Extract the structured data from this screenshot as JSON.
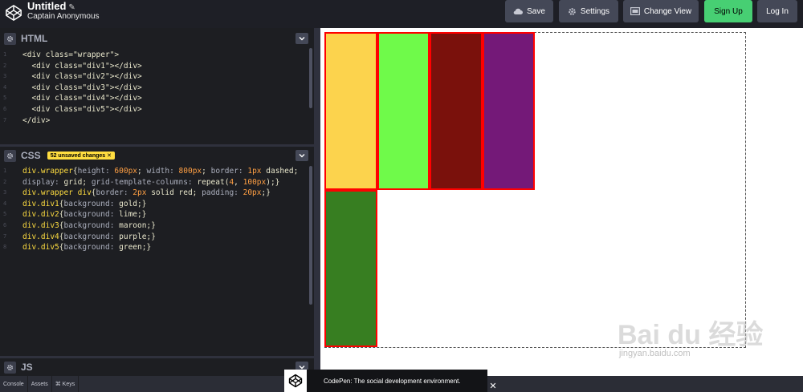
{
  "header": {
    "title": "Untitled",
    "author": "Captain Anonymous",
    "save_label": "Save",
    "settings_label": "Settings",
    "change_view_label": "Change View",
    "signup_label": "Sign Up",
    "login_label": "Log In"
  },
  "html_pane": {
    "title": "HTML",
    "lines": [
      {
        "n": "1",
        "parts": [
          [
            "t-tag",
            "<div "
          ],
          [
            "t-attr",
            "class="
          ],
          [
            "t-str",
            "\"wrapper\""
          ],
          [
            "t-tag",
            ">"
          ]
        ]
      },
      {
        "n": "2",
        "parts": [
          [
            "t-p",
            "  "
          ],
          [
            "t-tag",
            "<div "
          ],
          [
            "t-attr",
            "class="
          ],
          [
            "t-str",
            "\"div1\""
          ],
          [
            "t-tag",
            "></div>"
          ]
        ]
      },
      {
        "n": "3",
        "parts": [
          [
            "t-p",
            "  "
          ],
          [
            "t-tag",
            "<div "
          ],
          [
            "t-attr",
            "class="
          ],
          [
            "t-str",
            "\"div2\""
          ],
          [
            "t-tag",
            "></div>"
          ]
        ]
      },
      {
        "n": "4",
        "parts": [
          [
            "t-p",
            "  "
          ],
          [
            "t-tag",
            "<div "
          ],
          [
            "t-attr",
            "class="
          ],
          [
            "t-str",
            "\"div3\""
          ],
          [
            "t-tag",
            "></div>"
          ]
        ]
      },
      {
        "n": "5",
        "parts": [
          [
            "t-p",
            "  "
          ],
          [
            "t-tag",
            "<div "
          ],
          [
            "t-attr",
            "class="
          ],
          [
            "t-str",
            "\"div4\""
          ],
          [
            "t-tag",
            "></div>"
          ]
        ]
      },
      {
        "n": "6",
        "parts": [
          [
            "t-p",
            "  "
          ],
          [
            "t-tag",
            "<div "
          ],
          [
            "t-attr",
            "class="
          ],
          [
            "t-str",
            "\"div5\""
          ],
          [
            "t-tag",
            "></div>"
          ]
        ]
      },
      {
        "n": "7",
        "parts": [
          [
            "t-tag",
            "</div>"
          ]
        ]
      }
    ]
  },
  "css_pane": {
    "title": "CSS",
    "unsaved_badge": "52 unsaved changes",
    "lines": [
      {
        "n": "1",
        "parts": [
          [
            "t-sel",
            "div.wrapper"
          ],
          [
            "t-p",
            "{"
          ],
          [
            "t-prop",
            "height: "
          ],
          [
            "t-num",
            "600px"
          ],
          [
            "t-p",
            "; "
          ],
          [
            "t-prop",
            "width: "
          ],
          [
            "t-num",
            "800px"
          ],
          [
            "t-p",
            "; "
          ],
          [
            "t-prop",
            "border: "
          ],
          [
            "t-num",
            "1px"
          ],
          [
            "t-val",
            " dashed"
          ],
          [
            "t-p",
            ";"
          ]
        ]
      },
      {
        "n": "2",
        "parts": [
          [
            "t-prop",
            "display: "
          ],
          [
            "t-val",
            "grid"
          ],
          [
            "t-p",
            "; "
          ],
          [
            "t-prop",
            "grid-template-columns: "
          ],
          [
            "t-val",
            "repeat("
          ],
          [
            "t-num",
            "4"
          ],
          [
            "t-p",
            ", "
          ],
          [
            "t-num",
            "100px"
          ],
          [
            "t-p",
            ");}"
          ]
        ]
      },
      {
        "n": "3",
        "parts": [
          [
            "t-sel",
            "div.wrapper div"
          ],
          [
            "t-p",
            "{"
          ],
          [
            "t-prop",
            "border: "
          ],
          [
            "t-num",
            "2px"
          ],
          [
            "t-val",
            " solid red"
          ],
          [
            "t-p",
            "; "
          ],
          [
            "t-prop",
            "padding: "
          ],
          [
            "t-num",
            "20px"
          ],
          [
            "t-p",
            ";}"
          ]
        ]
      },
      {
        "n": "4",
        "parts": [
          [
            "t-sel",
            "div.div1"
          ],
          [
            "t-p",
            "{"
          ],
          [
            "t-prop",
            "background: "
          ],
          [
            "t-val",
            "gold"
          ],
          [
            "t-p",
            ";}"
          ]
        ]
      },
      {
        "n": "5",
        "parts": [
          [
            "t-sel",
            "div.div2"
          ],
          [
            "t-p",
            "{"
          ],
          [
            "t-prop",
            "background: "
          ],
          [
            "t-val",
            "lime"
          ],
          [
            "t-p",
            ";}"
          ]
        ]
      },
      {
        "n": "6",
        "parts": [
          [
            "t-sel",
            "div.div3"
          ],
          [
            "t-p",
            "{"
          ],
          [
            "t-prop",
            "background: "
          ],
          [
            "t-val",
            "maroon"
          ],
          [
            "t-p",
            ";}"
          ]
        ]
      },
      {
        "n": "7",
        "parts": [
          [
            "t-sel",
            "div.div4"
          ],
          [
            "t-p",
            "{"
          ],
          [
            "t-prop",
            "background: "
          ],
          [
            "t-val",
            "purple"
          ],
          [
            "t-p",
            ";}"
          ]
        ]
      },
      {
        "n": "8",
        "parts": [
          [
            "t-sel",
            "div.div5"
          ],
          [
            "t-p",
            "{"
          ],
          [
            "t-prop",
            "background: "
          ],
          [
            "t-val",
            "green"
          ],
          [
            "t-p",
            ";}"
          ]
        ]
      }
    ]
  },
  "js_pane": {
    "title": "JS"
  },
  "bottom_bar": {
    "console_label": "Console",
    "assets_label": "Assets",
    "keys_label": "⌘ Keys"
  },
  "preview": {
    "cells": [
      {
        "name": "div1",
        "color": "#fcd34d"
      },
      {
        "name": "div2",
        "color": "#6ffa4a"
      },
      {
        "name": "div3",
        "color": "#7a110c"
      },
      {
        "name": "div4",
        "color": "#741978"
      },
      {
        "name": "div5",
        "color": "#377e21"
      }
    ]
  },
  "toast": {
    "message": "CodePen: The social development environment."
  },
  "watermark": {
    "main": "Bai du 经验",
    "sub": "jingyan.baidu.com"
  }
}
